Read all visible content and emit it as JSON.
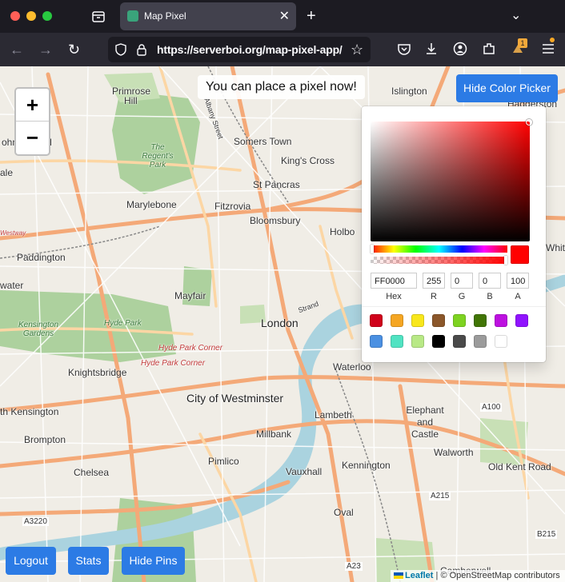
{
  "browser": {
    "tab_title": "Map Pixel",
    "url": "https://serverboi.org/map-pixel-app/",
    "extensions_badge": "1"
  },
  "map": {
    "labels": {
      "primrose": "Primrose",
      "hill": "Hill",
      "johns_wood": "ohn's Wood",
      "regents_park": "The Regent's Park",
      "albany_street": "Albany Street",
      "somers_town": "Somers Town",
      "kings_cross": "King's Cross",
      "islington": "Islington",
      "haggerston": "Haggerston",
      "vale": "ale",
      "st_pancras": "St Pancras",
      "marylebone": "Marylebone",
      "fitzrovia": "Fitzrovia",
      "bloomsbury": "Bloomsbury",
      "holborn": "Holbo",
      "westway": "Westway",
      "paddington": "Paddington",
      "white": "White",
      "water": "water",
      "mayfair": "Mayfair",
      "kensington_gardens": "Kensington Gardens",
      "hyde_park": "Hyde Park",
      "london": "London",
      "strand": "Strand",
      "hyde_park_corner_1": "Hyde Park Corner",
      "hyde_park_corner_2": "Hyde Park Corner",
      "knightsbridge": "Knightsbridge",
      "waterloo": "Waterloo",
      "city_of_westminster": "City of Westminster",
      "south_kensington": "th Kensington",
      "lambeth": "Lambeth",
      "elephant_and_castle": "Elephant and Castle",
      "a100": "A100",
      "brompton": "Brompton",
      "millbank": "Millbank",
      "walworth": "Walworth",
      "chelsea": "Chelsea",
      "pimlico": "Pimlico",
      "kennington": "Kennington",
      "old_kent_road": "Old Kent Road",
      "vauxhall": "Vauxhall",
      "a3220": "A3220",
      "a215": "A215",
      "oval": "Oval",
      "b215": "B215",
      "a23": "A23",
      "camberwell": "Camberwell"
    }
  },
  "toast_text": "You can place a pixel now!",
  "buttons": {
    "hide_color_picker": "Hide Color Picker",
    "logout": "Logout",
    "stats": "Stats",
    "hide_pins": "Hide Pins",
    "zoom_in": "+",
    "zoom_out": "−"
  },
  "color_picker": {
    "hex": "FF0000",
    "r": "255",
    "g": "0",
    "b": "0",
    "a": "100",
    "labels": {
      "hex": "Hex",
      "r": "R",
      "g": "G",
      "b": "B",
      "a": "A"
    },
    "current_color": "#FF0000",
    "preset_colors": [
      "#D0021B",
      "#F5A623",
      "#F8E71C",
      "#8B572A",
      "#7ED321",
      "#417505",
      "#BD10E0",
      "#9013FE",
      "#4A90E2",
      "#50E3C2",
      "#B8E986",
      "#000000",
      "#4A4A4A",
      "#9B9B9B",
      "#FFFFFF"
    ]
  },
  "attribution": {
    "leaflet": "Leaflet",
    "separator": "|",
    "copyright": "© OpenStreetMap contributors"
  }
}
